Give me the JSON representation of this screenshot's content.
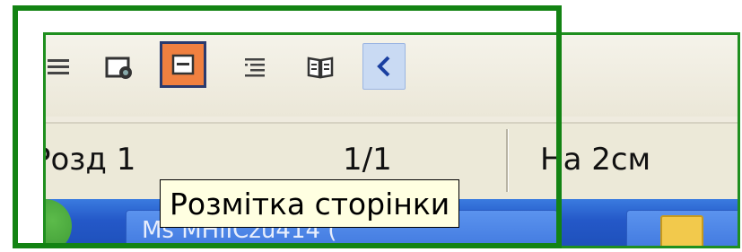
{
  "toolbar": {
    "icons": [
      {
        "name": "normal-view-icon"
      },
      {
        "name": "web-layout-icon"
      },
      {
        "name": "print-layout-icon",
        "active": true
      },
      {
        "name": "outline-view-icon"
      },
      {
        "name": "reading-layout-icon"
      },
      {
        "name": "chevron-left-icon"
      }
    ]
  },
  "statusbar": {
    "section": "Розд 1",
    "page": "1/1",
    "position": "На 2см"
  },
  "tooltip": {
    "text": "Розмітка сторінки"
  },
  "taskbar": {
    "button_text": "Ms MHlICzu414 ("
  },
  "colors": {
    "frame": "#138313",
    "active_button": "#f08040",
    "active_border": "#2a3a6e",
    "tooltip_bg": "#ffffe1",
    "taskbar": "#2458c8"
  }
}
